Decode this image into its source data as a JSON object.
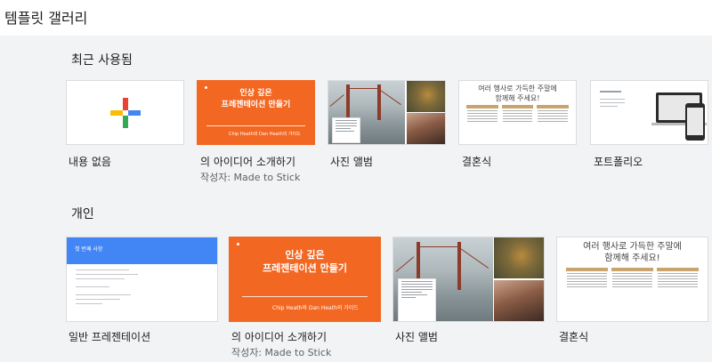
{
  "header": {
    "title": "템플릿 갤러리"
  },
  "sections": {
    "recent": {
      "title": "최근 사용됨",
      "cards": [
        {
          "label": "내용 없음"
        },
        {
          "label": "의 아이디어 소개하기",
          "sublabel": "작성자: Made to Stick",
          "thumb_title_1": "인상 깊은",
          "thumb_title_2": "프레젠테이션 만들기",
          "thumb_author": "Chip Heath와 Dan Heath의 가이드"
        },
        {
          "label": "사진 앨범"
        },
        {
          "label": "결혼식",
          "thumb_title_1": "여러 행사로 가득한 주말에",
          "thumb_title_2": "함께해 주세요!"
        },
        {
          "label": "포트폴리오"
        }
      ]
    },
    "personal": {
      "title": "개인",
      "cards": [
        {
          "label": "일반 프레젠테이션",
          "thumb_title": "첫 번째 사항"
        },
        {
          "label": "의 아이디어 소개하기",
          "sublabel": "작성자: Made to Stick",
          "thumb_title_1": "인상 깊은",
          "thumb_title_2": "프레젠테이션 만들기",
          "thumb_author": "Chip Heath와 Dan Heath의 가이드"
        },
        {
          "label": "사진 앨범"
        },
        {
          "label": "결혼식",
          "thumb_title_1": "여러 행사로 가득한 주말에",
          "thumb_title_2": "함께해 주세요!"
        }
      ]
    }
  },
  "colors": {
    "brand_orange": "#f26722",
    "brand_blue": "#4285f4",
    "wedding_gold": "#c9a46e",
    "background": "#f1f3f4"
  }
}
